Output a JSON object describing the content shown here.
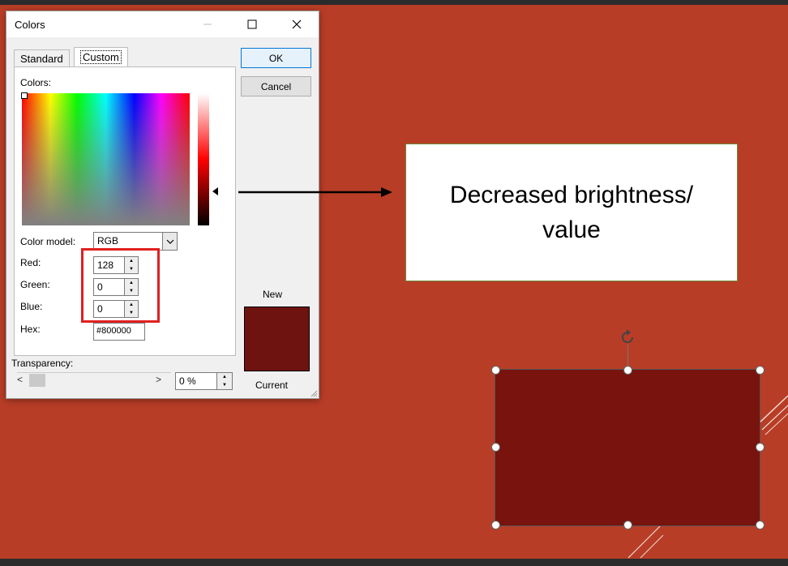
{
  "dialog": {
    "title": "Colors",
    "tabs": [
      {
        "label": "Standard",
        "active": false
      },
      {
        "label": "Custom",
        "active": true
      }
    ],
    "colors_label": "Colors:",
    "color_model_label": "Color model:",
    "color_model_value": "RGB",
    "red_label": "Red:",
    "red_value": "128",
    "green_label": "Green:",
    "green_value": "0",
    "blue_label": "Blue:",
    "blue_value": "0",
    "hex_label": "Hex:",
    "hex_value": "#800000",
    "ok_label": "OK",
    "cancel_label": "Cancel",
    "new_label": "New",
    "current_label": "Current",
    "transparency_label": "Transparency:",
    "transparency_value": "0 %"
  },
  "colors": {
    "new_swatch": "#6e1310",
    "current_swatch": "#6e1310",
    "shape_fill": "#78130e",
    "slide_bg": "#b83d26",
    "highlight_box": "#e02020"
  },
  "annotation": {
    "text": "Decreased brightness/ value"
  },
  "icons": {
    "minimize": "minimize-icon",
    "maximize": "maximize-icon",
    "close": "close-icon",
    "dropdown": "chevron-down-icon",
    "rotate": "rotate-handle-icon"
  }
}
